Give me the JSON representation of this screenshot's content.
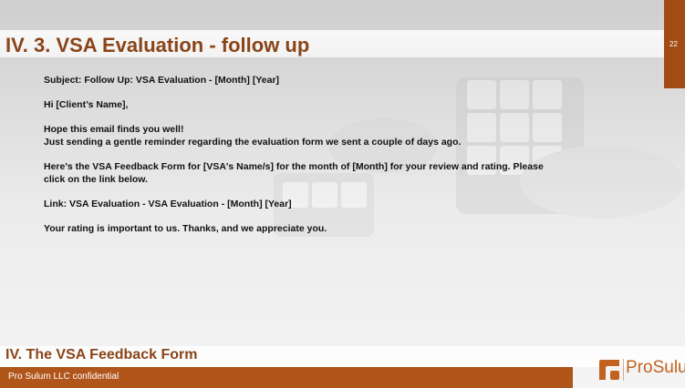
{
  "slide": {
    "title": "IV. 3. VSA Evaluation - follow up",
    "page_number": "22",
    "body": [
      "Subject: Follow Up: VSA Evaluation - [Month] [Year]",
      "Hi [Client’s Name],",
      "Hope this email finds you well!",
      "Just sending a gentle reminder regarding the evaluation form we sent a couple of days ago.",
      "Here's the VSA Feedback Form for [VSA's Name/s] for the month of [Month] for your review and rating. Please",
      "click on the link below.",
      "Link: VSA Evaluation - VSA Evaluation - [Month] [Year]",
      "Your rating is important to us. Thanks, and we appreciate you."
    ],
    "footer_title": "IV. The VSA Feedback Form",
    "confidential": "Pro Sulum LLC confidential",
    "logo": {
      "part1": "Pro",
      "part2": "Sulum",
      "icon": "prosulum-logo-icon"
    },
    "colors": {
      "accent": "#a34b15",
      "title": "#8a4418",
      "footer_bar": "#b0561b",
      "logo": "#c2621f"
    }
  }
}
